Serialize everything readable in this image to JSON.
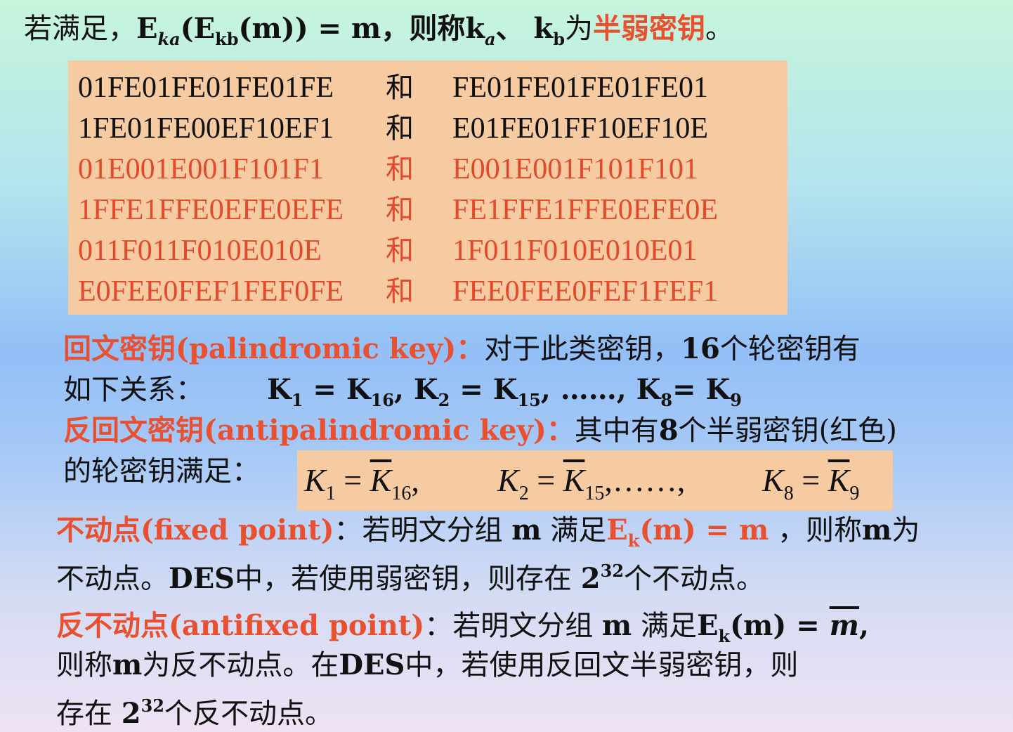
{
  "top": {
    "prefix": "若满足，",
    "formula_E1": "E",
    "sub_ka1": "ka",
    "formula_mid": "(E",
    "sub_kb": "kb",
    "formula_end": "(m)) = m，则称k",
    "sub_a": "a",
    "sep": "、 k",
    "sub_b": "b",
    "wei": "为",
    "highlight": "半弱密钥",
    "period": "。"
  },
  "key_pairs": [
    {
      "left": "01FE01FE01FE01FE",
      "and": "和",
      "right": "FE01FE01FE01FE01"
    },
    {
      "left": "1FE01FE00EF10EF1",
      "and": "和",
      "right": "E01FE01FF10EF10E"
    },
    {
      "left": "01E001E001F101F1",
      "and": "和",
      "right": "E001E001F101F101"
    },
    {
      "left": "1FFE1FFE0EFE0EFE",
      "and": "和",
      "right": "FE1FFE1FFE0EFE0E"
    },
    {
      "left": "011F011F010E010E",
      "and": "和",
      "right": "1F011F010E010E01"
    },
    {
      "left": "E0FEE0FEF1FEF0FE",
      "and": "和",
      "right": "FEE0FEE0FEF1FEF1"
    }
  ],
  "palindromic": {
    "term": "回文密钥(palindromic key)：",
    "desc": "对于此类密钥，",
    "desc_b": "16",
    "desc_end": "个轮密钥有",
    "line2_prefix": "如下关系：",
    "k1": "K",
    "s1": "1",
    "eq1": " = K",
    "s16": "16",
    "c1": ",  K",
    "s2": "2",
    "eq2": " = K",
    "s15": "15",
    "dots": ", ……,  K",
    "s8": "8",
    "eq3": "= K",
    "s9": "9"
  },
  "antipalindromic": {
    "term": "反回文密钥(antipalindromic key)：",
    "desc": "其中有",
    "desc_b": "8",
    "desc_end": "个半弱密钥(红色)",
    "line2": "的轮密钥满足：",
    "formula": [
      {
        "k": "K",
        "ks": "1",
        "eq": " = ",
        "bar": "K",
        "bs": "16",
        "tail": ","
      },
      {
        "k": "K",
        "ks": "2",
        "eq": " = ",
        "bar": "K",
        "bs": "15",
        "tail": ",……,"
      },
      {
        "k": "K",
        "ks": "8",
        "eq": " = ",
        "bar": "K",
        "bs": "9",
        "tail": ""
      }
    ]
  },
  "fixed": {
    "term": "不动点(fixed point)",
    "colon": "：若明文分组 ",
    "m": "m",
    "mid": " 满足",
    "red_e": "E",
    "red_k": "k",
    "red_rest": "(m) = m",
    "after": " ，则称",
    "m2": "m",
    "wei": "为",
    "line2_a": "不动点。",
    "des": "DES",
    "line2_b": "中，若使用弱密钥，则存在 ",
    "pow_base": "2",
    "pow_exp": "32",
    "line2_c": "个不动点。"
  },
  "antifixed": {
    "term": "反不动点(antifixed point)",
    "colon": "：若明文分组 ",
    "m": "m",
    "mid": " 满足",
    "e": "E",
    "k": "k",
    "rest": "(m) = ",
    "mbar": "m",
    "comma": ",",
    "line2_a": "则称",
    "m2": "m",
    "line2_b": "为反不动点。在",
    "des": "DES",
    "line2_c": "中，若使用反回文半弱密钥，则",
    "line3_a": "存在 ",
    "pow_base": "2",
    "pow_exp": "32",
    "line3_b": "个反不动点。"
  }
}
